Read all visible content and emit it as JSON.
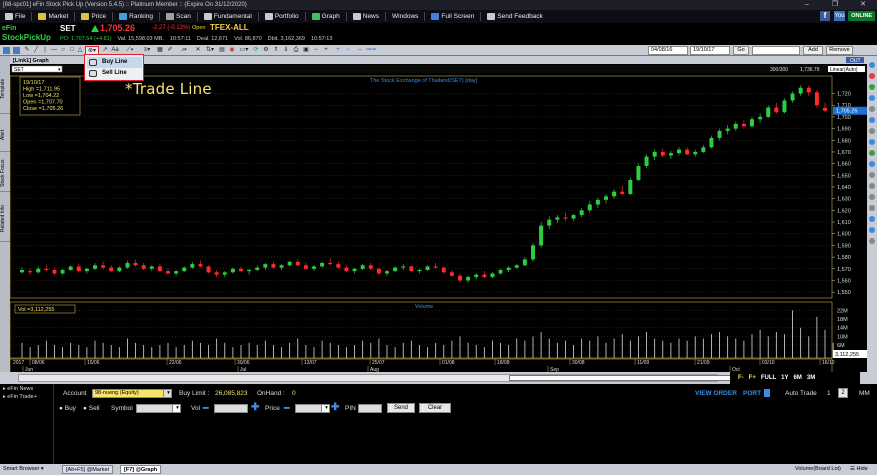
{
  "window": {
    "title": "[88-spc01] eFin Stock Pick Up (Version 5.4.5) :: Platinum Member :: (Expire On 31/12/2020)",
    "controls": [
      "–",
      "❐",
      "✕"
    ]
  },
  "menu": {
    "items": [
      {
        "label": "File",
        "color": "#c8c8d0"
      },
      {
        "label": "Market",
        "color": "#e0c040"
      },
      {
        "label": "Price",
        "color": "#e0c040"
      },
      {
        "label": "Ranking",
        "color": "#40a0e0"
      },
      {
        "label": "Scan",
        "color": "#a0a0a0"
      },
      {
        "label": "Fundamental",
        "color": "#c8c8d0"
      },
      {
        "label": "Portfolio",
        "color": "#c8c8d0"
      },
      {
        "label": "Graph",
        "color": "#40c060"
      },
      {
        "label": "News",
        "color": "#c8c8d0"
      },
      {
        "label": "Windows",
        "color": ""
      },
      {
        "label": "Full Screen",
        "color": "#4080e0"
      },
      {
        "label": "Send Feedback",
        "color": "#c8c8d0"
      }
    ],
    "online": "ONLINE",
    "fb": "f",
    "yt": "You"
  },
  "quote": {
    "logo_line1": "eFin",
    "logo_line2": "StockPickUp",
    "symbol": "SET",
    "last": "1,705.26",
    "change": "-2.27 (-0.13%)",
    "open_label": "Open",
    "tfex": "TFEX-ALL",
    "row2": [
      {
        "text": "PO: 1,707.54 (+4.81)",
        "green": true
      },
      {
        "text": "Val. 15,598.03 MB.",
        "green": false
      },
      {
        "text": "10:57:11",
        "green": false
      },
      {
        "text": "Deal. 12,671",
        "green": false
      },
      {
        "text": "Vol. 86,870",
        "green": false
      },
      {
        "text": "Dbit. 3,162,369",
        "green": false
      },
      {
        "text": "10:57:13",
        "green": false
      }
    ]
  },
  "toolbar": {
    "aa": "Aa",
    "date_from": "04/08/16",
    "date_to": "19/10/17",
    "go": "Go",
    "add": "Add",
    "remove": "Remove"
  },
  "dropdown": {
    "items": [
      "Buy Line",
      "Sell Line"
    ]
  },
  "annotation": "*Trade Line",
  "chart": {
    "panel_title": "[Link1] Graph",
    "symbol_box": "SET",
    "header_center": "The Stock Exchange of Thailand(SET) [day]",
    "header_range": "300/300",
    "header_last": "1,736.79",
    "header_scale": "Linear(Auto)",
    "title_btn": "OUT",
    "info": {
      "date": "19/10/17",
      "high": "High  =1,711.95",
      "low": "Low   =1,704.22",
      "open": "Open  =1,707.70",
      "close": "Close  =1,705.26"
    },
    "price_ticks": [
      1720,
      1710,
      1700,
      1690,
      1680,
      1670,
      1660,
      1650,
      1640,
      1630,
      1620,
      1610,
      1600,
      1590,
      1580,
      1570,
      1560,
      1550
    ],
    "price_ticks_label": [
      "1,720",
      "1,710",
      "1,700",
      "1,690",
      "1,680",
      "1,670",
      "1,660",
      "1,650",
      "1,640",
      "1,630",
      "1,620",
      "1,610",
      "1,600",
      "1,590",
      "1,580",
      "1,570",
      "1,560",
      "1,550"
    ],
    "price_range": [
      1545,
      1735
    ],
    "last_badge": "1,705.26",
    "volume_title": "Volume",
    "vol_box": "Vol  =3,112,255",
    "vol_ticks": [
      "22M",
      "18M",
      "14M",
      "10M",
      "6M"
    ],
    "vol_last": "3,112,255",
    "date_labels": [
      "2017",
      "08/06",
      "15/06",
      "22/06",
      "30/06",
      "13/07",
      "25/07",
      "01/08",
      "18/08",
      "30/08",
      "11/09",
      "21/09",
      "03/10",
      "16/10"
    ],
    "month_labels": [
      "Jun",
      "Jul",
      "Aug",
      "Sep",
      "Oct"
    ],
    "nav_labels": [
      "FULL",
      "1Y",
      "6M",
      "3M"
    ],
    "candles": [
      [
        1567,
        1571,
        1566,
        1569
      ],
      [
        1568,
        1570,
        1565,
        1567
      ],
      [
        1567,
        1572,
        1566,
        1570
      ],
      [
        1570,
        1573,
        1568,
        1569
      ],
      [
        1569,
        1571,
        1564,
        1566
      ],
      [
        1566,
        1570,
        1565,
        1569
      ],
      [
        1569,
        1573,
        1568,
        1572
      ],
      [
        1572,
        1574,
        1567,
        1568
      ],
      [
        1568,
        1571,
        1566,
        1570
      ],
      [
        1570,
        1575,
        1569,
        1573
      ],
      [
        1573,
        1576,
        1570,
        1571
      ],
      [
        1571,
        1573,
        1567,
        1568
      ],
      [
        1568,
        1572,
        1567,
        1571
      ],
      [
        1571,
        1577,
        1570,
        1575
      ],
      [
        1575,
        1578,
        1572,
        1573
      ],
      [
        1573,
        1575,
        1569,
        1570
      ],
      [
        1570,
        1573,
        1568,
        1572
      ],
      [
        1572,
        1574,
        1567,
        1568
      ],
      [
        1568,
        1570,
        1565,
        1566
      ],
      [
        1566,
        1569,
        1564,
        1568
      ],
      [
        1568,
        1572,
        1567,
        1571
      ],
      [
        1571,
        1576,
        1570,
        1574
      ],
      [
        1574,
        1577,
        1571,
        1572
      ],
      [
        1572,
        1573,
        1566,
        1567
      ],
      [
        1567,
        1569,
        1563,
        1565
      ],
      [
        1565,
        1568,
        1563,
        1567
      ],
      [
        1567,
        1571,
        1566,
        1570
      ],
      [
        1570,
        1572,
        1567,
        1568
      ],
      [
        1568,
        1570,
        1565,
        1569
      ],
      [
        1569,
        1573,
        1568,
        1571
      ],
      [
        1571,
        1575,
        1569,
        1574
      ],
      [
        1574,
        1576,
        1570,
        1571
      ],
      [
        1571,
        1574,
        1569,
        1573
      ],
      [
        1573,
        1577,
        1572,
        1576
      ],
      [
        1576,
        1578,
        1572,
        1573
      ],
      [
        1573,
        1575,
        1569,
        1570
      ],
      [
        1570,
        1573,
        1568,
        1572
      ],
      [
        1572,
        1576,
        1571,
        1575
      ],
      [
        1575,
        1579,
        1573,
        1574
      ],
      [
        1574,
        1576,
        1570,
        1571
      ],
      [
        1571,
        1573,
        1567,
        1568
      ],
      [
        1568,
        1571,
        1566,
        1570
      ],
      [
        1570,
        1574,
        1569,
        1573
      ],
      [
        1573,
        1575,
        1569,
        1570
      ],
      [
        1570,
        1571,
        1565,
        1566
      ],
      [
        1566,
        1569,
        1564,
        1568
      ],
      [
        1568,
        1572,
        1567,
        1571
      ],
      [
        1571,
        1574,
        1569,
        1572
      ],
      [
        1572,
        1573,
        1567,
        1568
      ],
      [
        1568,
        1570,
        1566,
        1569
      ],
      [
        1569,
        1573,
        1568,
        1572
      ],
      [
        1572,
        1575,
        1570,
        1571
      ],
      [
        1571,
        1572,
        1566,
        1567
      ],
      [
        1567,
        1569,
        1563,
        1564
      ],
      [
        1564,
        1566,
        1558,
        1560
      ],
      [
        1560,
        1564,
        1558,
        1563
      ],
      [
        1563,
        1566,
        1561,
        1565
      ],
      [
        1565,
        1568,
        1562,
        1563
      ],
      [
        1563,
        1567,
        1562,
        1566
      ],
      [
        1566,
        1570,
        1565,
        1569
      ],
      [
        1569,
        1572,
        1567,
        1571
      ],
      [
        1571,
        1574,
        1570,
        1573
      ],
      [
        1573,
        1580,
        1572,
        1578
      ],
      [
        1578,
        1592,
        1576,
        1590
      ],
      [
        1590,
        1610,
        1588,
        1607
      ],
      [
        1607,
        1615,
        1604,
        1612
      ],
      [
        1612,
        1616,
        1609,
        1614
      ],
      [
        1614,
        1618,
        1611,
        1613
      ],
      [
        1613,
        1617,
        1611,
        1616
      ],
      [
        1616,
        1622,
        1614,
        1620
      ],
      [
        1620,
        1628,
        1618,
        1625
      ],
      [
        1625,
        1631,
        1622,
        1629
      ],
      [
        1629,
        1634,
        1626,
        1632
      ],
      [
        1632,
        1638,
        1630,
        1636
      ],
      [
        1636,
        1641,
        1633,
        1634
      ],
      [
        1634,
        1648,
        1633,
        1646
      ],
      [
        1646,
        1660,
        1645,
        1658
      ],
      [
        1658,
        1668,
        1656,
        1666
      ],
      [
        1666,
        1672,
        1663,
        1670
      ],
      [
        1670,
        1673,
        1665,
        1667
      ],
      [
        1667,
        1671,
        1664,
        1669
      ],
      [
        1669,
        1674,
        1667,
        1672
      ],
      [
        1672,
        1674,
        1667,
        1668
      ],
      [
        1668,
        1672,
        1666,
        1670
      ],
      [
        1670,
        1676,
        1669,
        1674
      ],
      [
        1674,
        1684,
        1673,
        1682
      ],
      [
        1682,
        1690,
        1680,
        1688
      ],
      [
        1688,
        1693,
        1685,
        1690
      ],
      [
        1690,
        1696,
        1688,
        1694
      ],
      [
        1694,
        1697,
        1690,
        1692
      ],
      [
        1692,
        1700,
        1691,
        1698
      ],
      [
        1698,
        1703,
        1695,
        1700
      ],
      [
        1700,
        1710,
        1699,
        1708
      ],
      [
        1708,
        1712,
        1703,
        1704
      ],
      [
        1704,
        1716,
        1703,
        1714
      ],
      [
        1714,
        1722,
        1712,
        1720
      ],
      [
        1720,
        1727,
        1718,
        1725
      ],
      [
        1725,
        1727,
        1718,
        1721
      ],
      [
        1721,
        1723,
        1708,
        1710
      ],
      [
        1707.7,
        1711.95,
        1704.22,
        1705.26
      ]
    ],
    "volumes": [
      7,
      5,
      6,
      8,
      6,
      5,
      7,
      6,
      5,
      8,
      7,
      6,
      5,
      9,
      7,
      6,
      5,
      6,
      7,
      5,
      6,
      8,
      7,
      6,
      9,
      7,
      5,
      6,
      7,
      6,
      8,
      6,
      5,
      7,
      9,
      6,
      5,
      8,
      7,
      6,
      5,
      6,
      8,
      7,
      9,
      6,
      5,
      7,
      8,
      6,
      5,
      7,
      6,
      8,
      10,
      7,
      6,
      5,
      8,
      7,
      6,
      9,
      8,
      10,
      12,
      9,
      7,
      8,
      6,
      9,
      8,
      10,
      7,
      9,
      11,
      8,
      10,
      12,
      9,
      8,
      7,
      9,
      8,
      10,
      9,
      11,
      12,
      10,
      9,
      8,
      11,
      13,
      10,
      12,
      11,
      22,
      14,
      10,
      19,
      13,
      7
    ]
  },
  "bottom": {
    "nav": [
      "FULL",
      "1Y",
      "6M",
      "3M"
    ],
    "left_items": [
      "eFin News",
      "eFin Trade+"
    ]
  },
  "order": {
    "account_label": "Account",
    "account_value": "98-nueng (Equity)",
    "buy_limit_label": "Buy Limit :",
    "buy_limit_value": "26,085,823",
    "onhand_label": "OnHand :",
    "onhand_value": "0",
    "view_order": "VIEW ORDER",
    "port": "PORT",
    "auto_trade": "Auto Trade",
    "page1": "1",
    "page2": "2",
    "mm": "MM",
    "buy": "Buy",
    "sell": "Sell",
    "symbol_label": "Symbol",
    "vol_label": "Vol",
    "price_label": "Price",
    "pin_label": "PIN",
    "send": "Send",
    "clear": "Clear"
  },
  "status": {
    "smart_browser": "Smart Browser",
    "tab1": "[Alt+F5] @Market",
    "tab2": "[F7] @Graph",
    "right": "Volume(Board Lot)",
    "hide": "Hide"
  },
  "sidetabs": [
    "Template",
    "Alert",
    "Stock Focus",
    "Related Info"
  ]
}
